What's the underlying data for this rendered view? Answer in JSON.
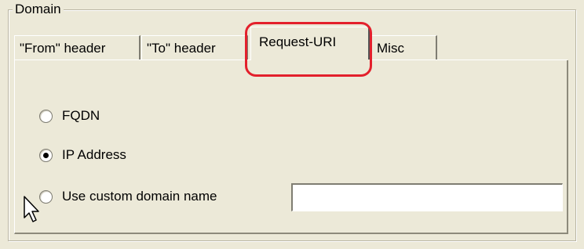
{
  "group": {
    "title": "Domain"
  },
  "tabs": [
    {
      "label": "\"From\" header"
    },
    {
      "label": "\"To\" header"
    },
    {
      "label": "Request-URI"
    },
    {
      "label": "Misc"
    }
  ],
  "panel": {
    "options": [
      {
        "label": "FQDN",
        "checked": false
      },
      {
        "label": "IP Address",
        "checked": true
      },
      {
        "label": "Use custom domain name",
        "checked": false
      }
    ],
    "custom_domain": {
      "value": ""
    }
  },
  "colors": {
    "dialog_bg": "#ece9d8",
    "highlight": "#e3202c"
  },
  "icons": {
    "cursor": "arrow-cursor-icon"
  }
}
